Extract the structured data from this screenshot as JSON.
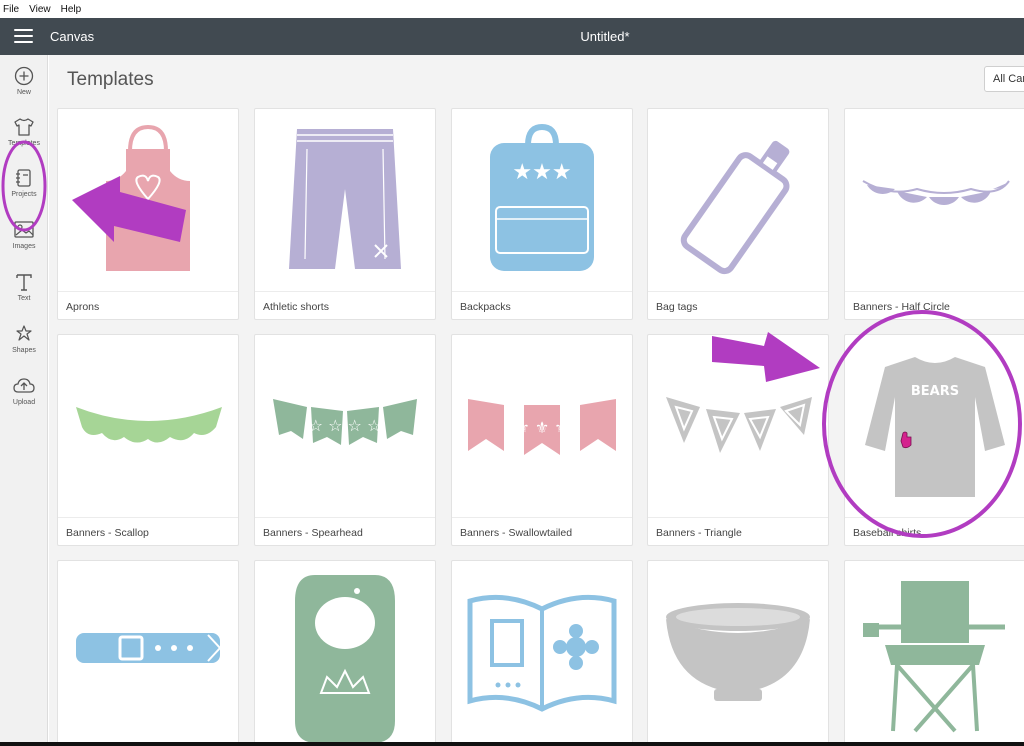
{
  "menu": {
    "items": [
      "File",
      "View",
      "Help"
    ]
  },
  "header": {
    "app_title": "Canvas",
    "doc_title": "Untitled*"
  },
  "sidebar": {
    "items": [
      {
        "label": "New",
        "icon": "plus-circle-icon"
      },
      {
        "label": "Templates",
        "icon": "tshirt-icon"
      },
      {
        "label": "Projects",
        "icon": "notebook-icon"
      },
      {
        "label": "Images",
        "icon": "image-icon"
      },
      {
        "label": "Text",
        "icon": "text-T-icon"
      },
      {
        "label": "Shapes",
        "icon": "shapes-icon"
      },
      {
        "label": "Upload",
        "icon": "cloud-upload-icon"
      }
    ]
  },
  "main": {
    "title": "Templates",
    "filter_label": "All Canvas",
    "templates": [
      {
        "label": "Aprons"
      },
      {
        "label": "Athletic shorts"
      },
      {
        "label": "Backpacks"
      },
      {
        "label": "Bag tags"
      },
      {
        "label": "Banners - Half Circle"
      },
      {
        "label": "Banners - Scallop"
      },
      {
        "label": "Banners - Spearhead"
      },
      {
        "label": "Banners - Swallowtailed"
      },
      {
        "label": "Banners - Triangle"
      },
      {
        "label": "Baseball shirts"
      },
      {
        "label": ""
      },
      {
        "label": ""
      },
      {
        "label": ""
      },
      {
        "label": ""
      },
      {
        "label": ""
      }
    ],
    "shirt_text": "BEARS"
  },
  "colors": {
    "header": "#414a51",
    "annotation": "#b13cc1",
    "apron": "#e8a5ae",
    "lavender": "#b6afd4",
    "blue": "#8dc2e3",
    "green": "#a6d596",
    "sage": "#8fb79b",
    "pink": "#e8a5ae",
    "gray": "#c4c4c4"
  }
}
